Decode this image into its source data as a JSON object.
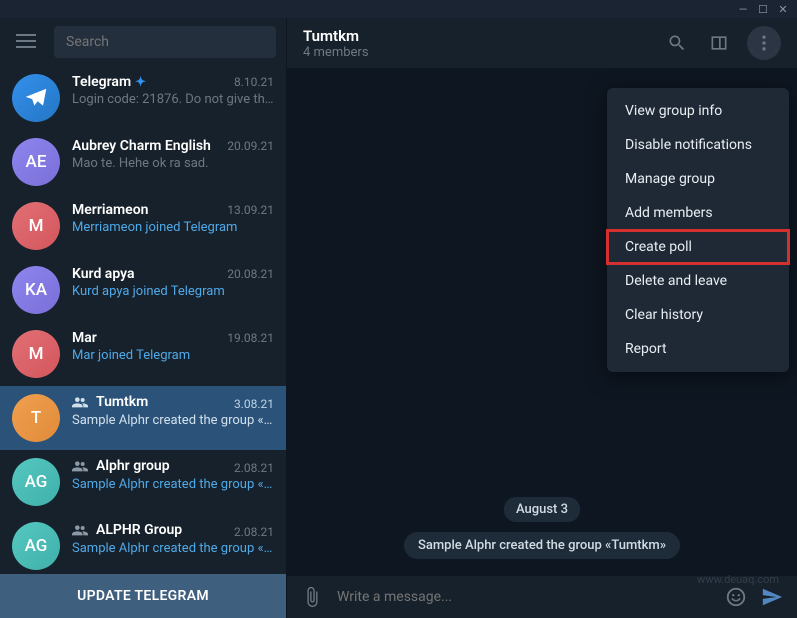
{
  "window": {
    "min": "—",
    "max": "☐",
    "close": "✕"
  },
  "search": {
    "placeholder": "Search"
  },
  "chats": [
    {
      "avatar_type": "tg",
      "initials": "",
      "name": "Telegram",
      "verified": true,
      "date": "8.10.21",
      "preview": "Login code: 21876. Do not give thi…",
      "link": false,
      "group": false
    },
    {
      "avatar_type": "purple",
      "initials": "AE",
      "name": "Aubrey Charm English",
      "verified": false,
      "date": "20.09.21",
      "preview": "Mao te. Hehe ok ra sad.",
      "link": false,
      "group": false
    },
    {
      "avatar_type": "red",
      "initials": "M",
      "name": "Merriameon",
      "verified": false,
      "date": "13.09.21",
      "preview": "Merriameon joined Telegram",
      "link": true,
      "group": false
    },
    {
      "avatar_type": "purple",
      "initials": "KA",
      "name": "Kurd apya",
      "verified": false,
      "date": "20.08.21",
      "preview": "Kurd apya joined Telegram",
      "link": true,
      "group": false
    },
    {
      "avatar_type": "red",
      "initials": "M",
      "name": "Mar",
      "verified": false,
      "date": "19.08.21",
      "preview": "Mar joined Telegram",
      "link": true,
      "group": false
    },
    {
      "avatar_type": "orange",
      "initials": "T",
      "name": "Tumtkm",
      "verified": false,
      "date": "3.08.21",
      "preview": "Sample Alphr created the group «…",
      "link": false,
      "group": true,
      "selected": true
    },
    {
      "avatar_type": "teal",
      "initials": "AG",
      "name": "Alphr group",
      "verified": false,
      "date": "2.08.21",
      "preview": "Sample Alphr created the group «…",
      "link": true,
      "group": true
    },
    {
      "avatar_type": "teal",
      "initials": "AG",
      "name": "ALPHR Group",
      "verified": false,
      "date": "2.08.21",
      "preview": "Sample Alphr created the group «…",
      "link": true,
      "group": true
    }
  ],
  "update_button": "UPDATE TELEGRAM",
  "header": {
    "title": "Tumtkm",
    "subtitle": "4 members"
  },
  "dropdown": [
    {
      "label": "View group info"
    },
    {
      "label": "Disable notifications"
    },
    {
      "label": "Manage group"
    },
    {
      "label": "Add members"
    },
    {
      "label": "Create poll",
      "highlighted": true
    },
    {
      "label": "Delete and leave"
    },
    {
      "label": "Clear history"
    },
    {
      "label": "Report"
    }
  ],
  "date_badge": "August 3",
  "system_message": "Sample Alphr created the group «Tumtkm»",
  "composer": {
    "placeholder": "Write a message..."
  },
  "watermark": "www.deuaq.com"
}
